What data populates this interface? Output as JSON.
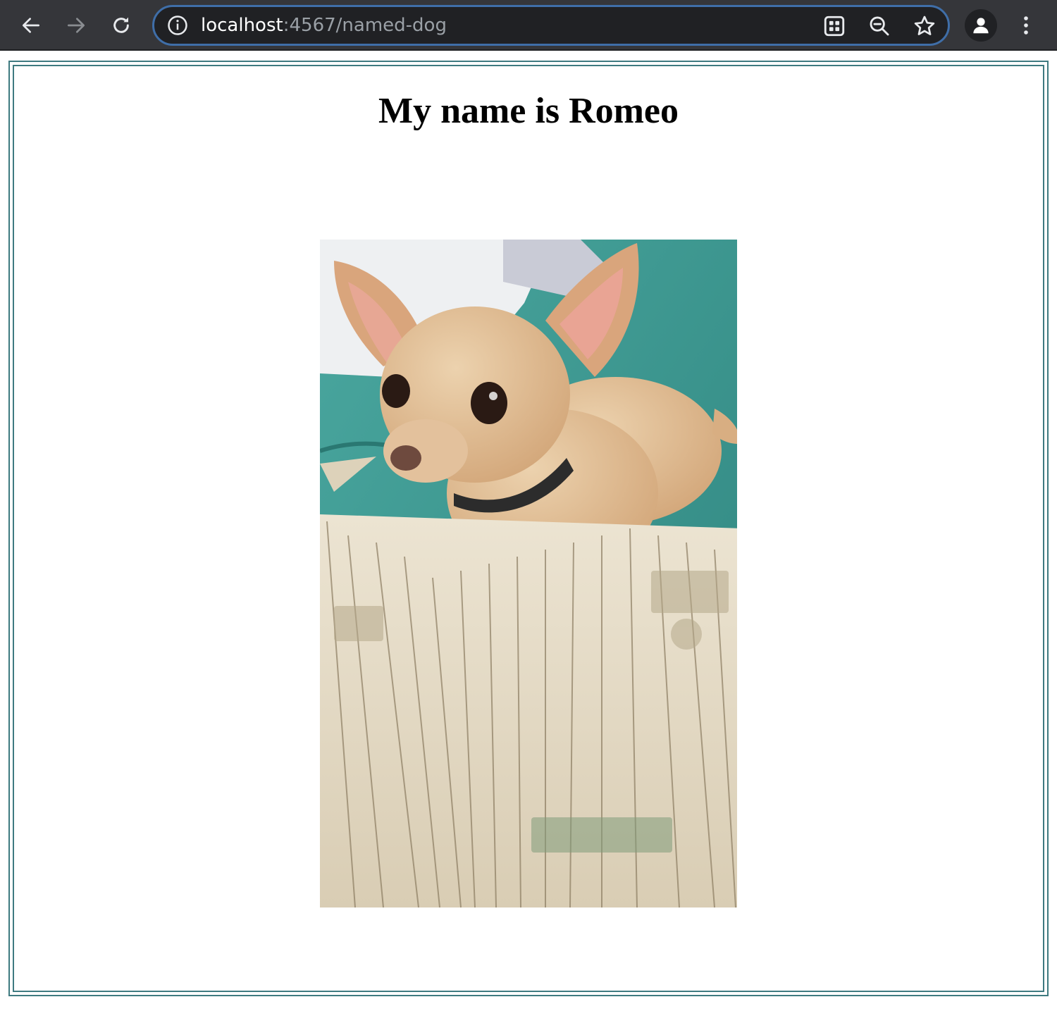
{
  "browser": {
    "url_host": "localhost",
    "url_path": ":4567/named-dog",
    "icons": {
      "back": "arrow-left-icon",
      "forward": "arrow-right-icon",
      "reload": "reload-icon",
      "site_info": "info-icon",
      "app": "app-grid-icon",
      "zoom": "zoom-out-icon",
      "bookmark": "star-icon",
      "profile": "person-icon",
      "menu": "kebab-menu-icon"
    },
    "colors": {
      "toolbar": "#35363a",
      "omnibox": "#202124",
      "focus_ring": "#3f6ea8",
      "url_path": "#9aa0a6"
    }
  },
  "page": {
    "heading": "My name is Romeo",
    "photo": {
      "subject": "chihuahua-with-dollar-bills",
      "colors": {
        "sheet": "#3b9a94",
        "dog": "#e2bf95",
        "money": "#e6dcc6"
      }
    },
    "frame_color": "#3e7a80"
  }
}
